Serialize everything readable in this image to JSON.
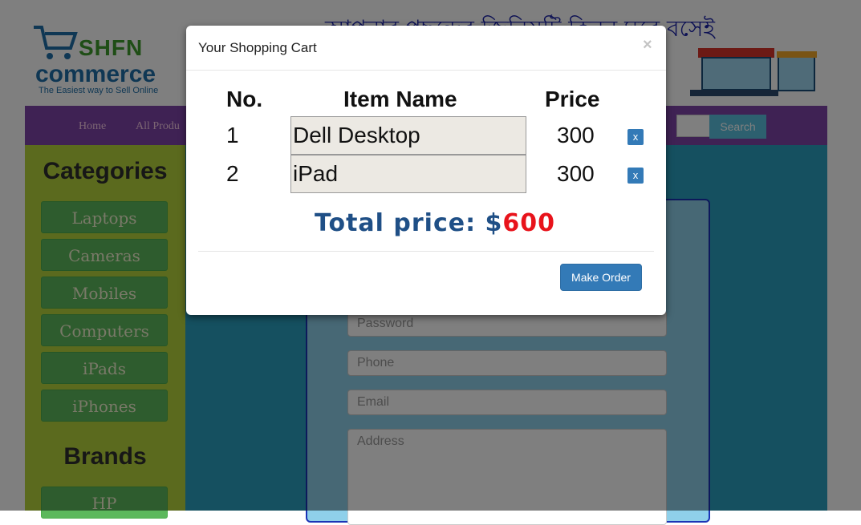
{
  "header": {
    "logo_brand": "SHFN",
    "logo_name": "commerce",
    "logo_tagline": "The Easiest way to Sell Online",
    "banner_text": "আপনার পছন্দের জিনিসটি কিনুন ঘরে বসেই"
  },
  "nav": {
    "items": [
      "Home",
      "All Produ"
    ],
    "search_button": "Search"
  },
  "sidebar": {
    "categories_heading": "Categories",
    "categories": [
      "Laptops",
      "Cameras",
      "Mobiles",
      "Computers",
      "iPads",
      "iPhones"
    ],
    "brands_heading": "Brands",
    "brands": [
      "HP"
    ]
  },
  "registration": {
    "fields": [
      "Password",
      "Phone",
      "Email",
      "Address"
    ]
  },
  "modal": {
    "title": "Your Shopping Cart",
    "close_symbol": "×",
    "columns": [
      "No.",
      "Item Name",
      "Price"
    ],
    "rows": [
      {
        "no": "1",
        "name": "Dell Desktop",
        "price": "300",
        "remove": "x"
      },
      {
        "no": "2",
        "name": "iPad",
        "price": "300",
        "remove": "x"
      }
    ],
    "total_label": "Total price:",
    "total_currency": "$",
    "total_amount": "600",
    "order_button": "Make Order"
  },
  "colors": {
    "navbar": "#7e44a8",
    "sidebar": "#b6d43c",
    "main": "#2aa1c0",
    "button_green": "#5cb85c",
    "primary": "#337ab7",
    "total_amount": "#e8131b"
  }
}
